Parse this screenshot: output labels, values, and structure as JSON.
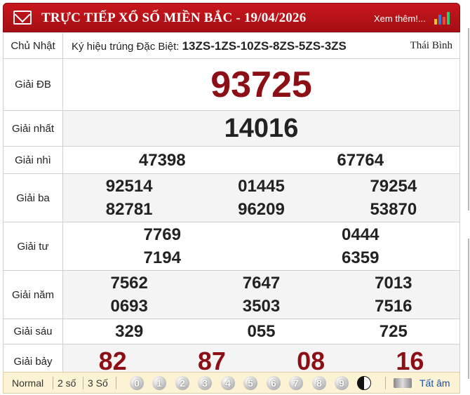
{
  "header": {
    "title": "TRỰC TIẾP XỔ SỐ MIỀN BẮC - 19/04/2026",
    "more_link": "Xem thêm!..."
  },
  "info": {
    "day": "Chủ Nhật",
    "special_code_label": "Ký hiệu trúng Đặc Biệt:",
    "special_code": "13ZS-1ZS-10ZS-8ZS-5ZS-3ZS",
    "province": "Thái Bình"
  },
  "prizes": {
    "db": {
      "label": "Giải ĐB",
      "numbers": [
        "93725"
      ]
    },
    "g1": {
      "label": "Giải nhất",
      "numbers": [
        "14016"
      ]
    },
    "g2": {
      "label": "Giải nhì",
      "numbers": [
        "47398",
        "67764"
      ]
    },
    "g3": {
      "label": "Giải ba",
      "numbers": [
        "92514",
        "01445",
        "79254",
        "82781",
        "96209",
        "53870"
      ]
    },
    "g4": {
      "label": "Giải tư",
      "numbers": [
        "7769",
        "0444",
        "7194",
        "6359"
      ]
    },
    "g5": {
      "label": "Giải năm",
      "numbers": [
        "7562",
        "7647",
        "7013",
        "0693",
        "3503",
        "7516"
      ]
    },
    "g6": {
      "label": "Giải sáu",
      "numbers": [
        "329",
        "055",
        "725"
      ]
    },
    "g7": {
      "label": "Giải bảy",
      "numbers": [
        "82",
        "87",
        "08",
        "16"
      ]
    }
  },
  "toolbar": {
    "normal": "Normal",
    "two_digits": "2 số",
    "three_digits": "3 Số",
    "digits": [
      "0",
      "1",
      "2",
      "3",
      "4",
      "5",
      "6",
      "7",
      "8",
      "9"
    ],
    "show_all": "Tất âm"
  },
  "colors": {
    "header_red": "#b5121b",
    "special_red": "#8b0f14",
    "toolbar_bg": "#fbf3d4"
  }
}
